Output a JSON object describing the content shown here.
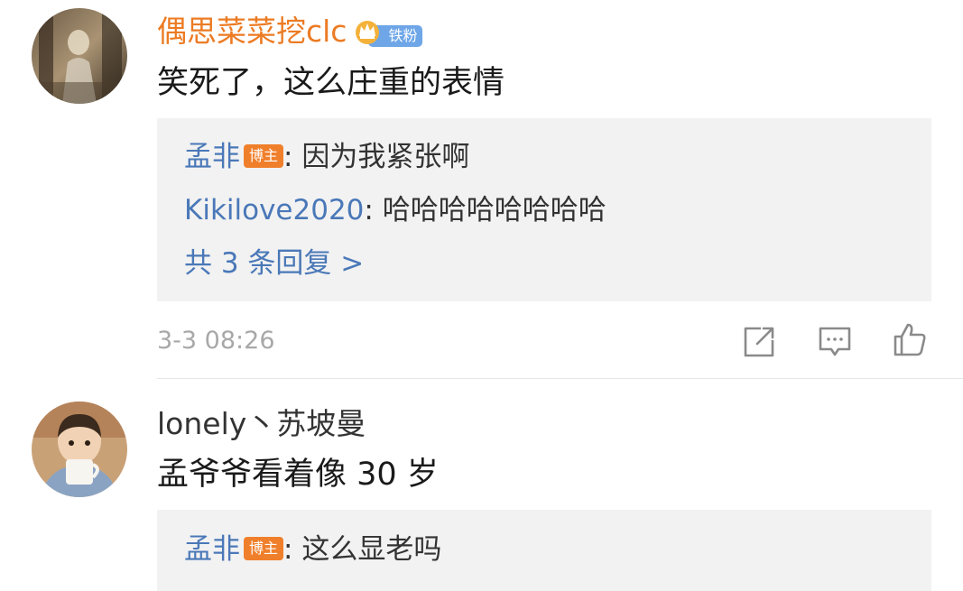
{
  "comments": [
    {
      "username": "偶思菜菜挖clc",
      "fan_badge": "铁粉",
      "text": "笑死了，这么庄重的表情",
      "replies": [
        {
          "name": "孟非",
          "host_tag": "博主",
          "text": ": 因为我紧张啊"
        },
        {
          "name": "Kikilove2020",
          "text": ": 哈哈哈哈哈哈哈哈"
        }
      ],
      "more_replies": "共 3 条回复 >",
      "time": "3-3 08:26",
      "actions": [
        "share-icon",
        "comment-icon",
        "like-icon"
      ]
    },
    {
      "username": "lonely丶苏坡曼",
      "text": "孟爷爷看着像 30 岁",
      "replies": [
        {
          "name": "孟非",
          "host_tag": "博主",
          "text": ": 这么显老吗"
        }
      ]
    }
  ],
  "colors": {
    "vip_name": "#ec7b23",
    "link": "#4a78b8",
    "host_tag": "#f07f2b",
    "fan_badge": "#6ea6e8",
    "reply_bg": "#f2f2f2",
    "meta": "#a8a8a8"
  }
}
